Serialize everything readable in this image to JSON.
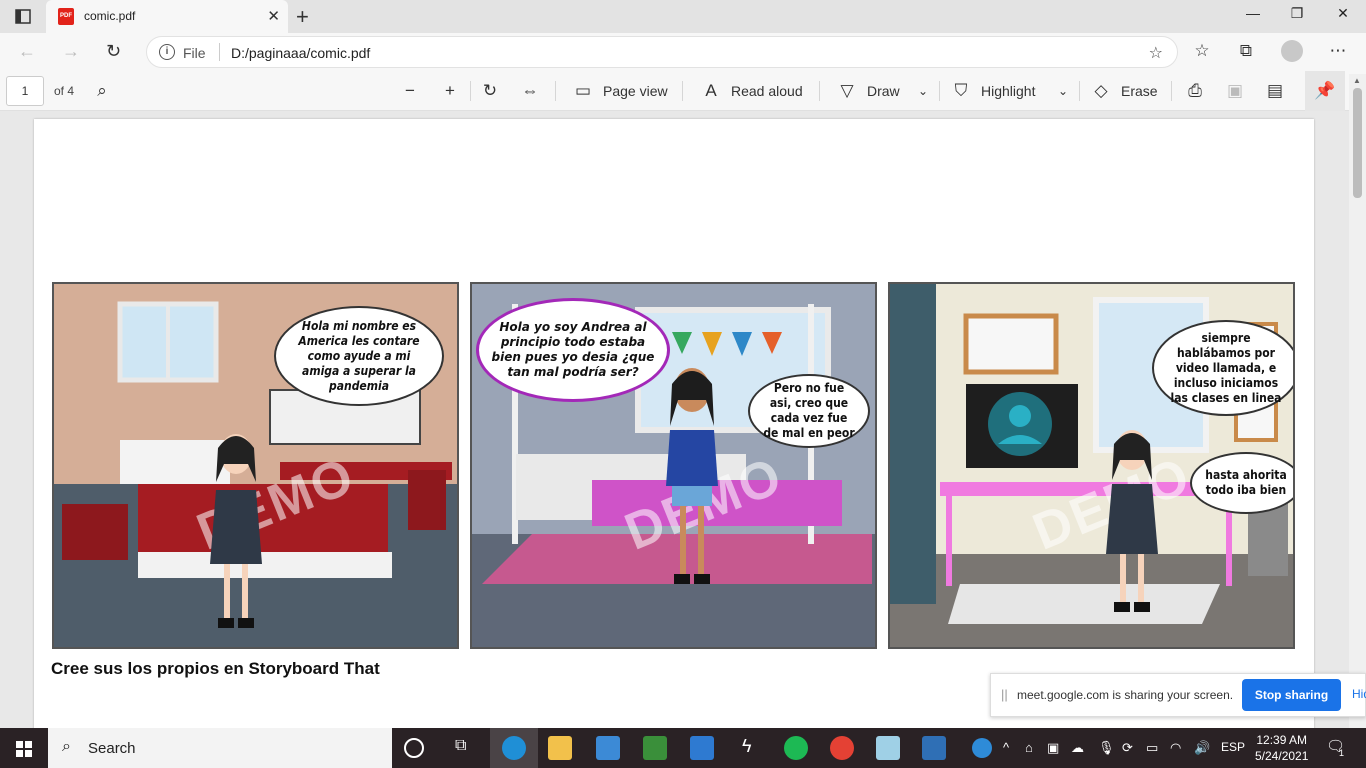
{
  "browser": {
    "tab_title": "comic.pdf",
    "tab_icon_text": "PDF",
    "address_prefix": "File",
    "url": "D:/paginaaa/comic.pdf"
  },
  "pdf_toolbar": {
    "page_number": "1",
    "page_total": "of 4",
    "page_view": "Page view",
    "read_aloud": "Read aloud",
    "draw": "Draw",
    "highlight": "Highlight",
    "erase": "Erase"
  },
  "comic": {
    "panel1_bubble": "Hola mi nombre es America les contare como ayude a mi amiga a superar la pandemia",
    "panel2_bubble_left": "Hola yo soy  Andrea al principio todo estaba bien pues yo desia ¿que tan mal podría ser?",
    "panel2_bubble_right": "Pero no fue asi, creo que cada vez fue de mal en peor",
    "panel3_bubble_top": "siempre hablábamos por video llamada, e incluso iniciamos las clases en linea",
    "panel3_bubble_bottom": "hasta ahorita todo iba bien",
    "watermark": "DEMO",
    "watermark_brand": "Storyboard",
    "caption": "Cree sus los propios en Storyboard That"
  },
  "share_banner": {
    "text": "meet.google.com is sharing your screen.",
    "stop": "Stop sharing",
    "hide": "Hide"
  },
  "taskbar": {
    "search": "Search",
    "language": "ESP",
    "time": "12:39 AM",
    "date": "5/24/2021",
    "notification_count": "1"
  }
}
